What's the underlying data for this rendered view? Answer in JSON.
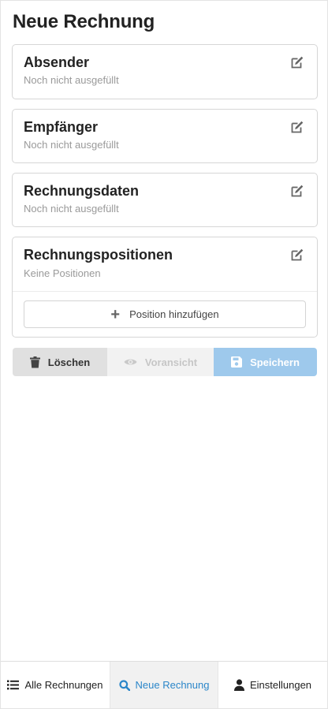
{
  "page": {
    "title": "Neue Rechnung"
  },
  "cards": [
    {
      "title": "Absender",
      "subtitle": "Noch nicht ausgefüllt"
    },
    {
      "title": "Empfänger",
      "subtitle": "Noch nicht ausgefüllt"
    },
    {
      "title": "Rechnungsdaten",
      "subtitle": "Noch nicht ausgefüllt"
    },
    {
      "title": "Rechnungspositionen",
      "subtitle": "Keine Positionen",
      "add_label": "Position hinzufügen"
    }
  ],
  "actions": {
    "delete_label": "Löschen",
    "preview_label": "Voransicht",
    "save_label": "Speichern"
  },
  "nav": {
    "all_label": "Alle Rechnungen",
    "new_label": "Neue Rechnung",
    "settings_label": "Einstellungen"
  },
  "colors": {
    "accent": "#2b86c9",
    "save_bg": "#9ec9ec",
    "delete_bg": "#e0e0e0",
    "preview_bg": "#f2f2f2",
    "active_nav_bg": "#f1f1f1"
  },
  "icons": {
    "edit": "edit-icon",
    "plus": "plus-icon",
    "trash": "trash-icon",
    "eye": "eye-icon",
    "save": "save-icon",
    "list": "list-icon",
    "search": "search-icon",
    "user": "user-icon"
  }
}
